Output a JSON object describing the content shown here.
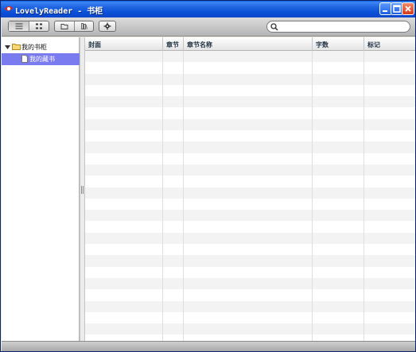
{
  "window": {
    "title": "LovelyReader - 书柜",
    "buttons": [
      "minimize",
      "maximize",
      "close"
    ]
  },
  "toolbar": {
    "view_buttons": [
      {
        "icon": "list-view-icon",
        "active": true
      },
      {
        "icon": "grid-view-icon",
        "active": false
      }
    ],
    "action_buttons": [
      {
        "icon": "folder-icon"
      },
      {
        "icon": "bookshelf-icon"
      }
    ],
    "settings_icon": "gear-icon",
    "search": {
      "value": "",
      "placeholder": "",
      "icon": "search-icon"
    }
  },
  "sidebar": {
    "root": {
      "label": "我的书柜",
      "expanded": true,
      "icon": "folder-icon"
    },
    "children": [
      {
        "label": "我的藏书",
        "selected": true,
        "icon": "document-icon"
      }
    ]
  },
  "table": {
    "columns": [
      "封面",
      "章节",
      "章节名称",
      "字数",
      "标记"
    ],
    "rows": []
  },
  "colors": {
    "titlebar": "#0850d8",
    "selection": "#7b7bf0",
    "row_alt": "#f3f3f3"
  }
}
